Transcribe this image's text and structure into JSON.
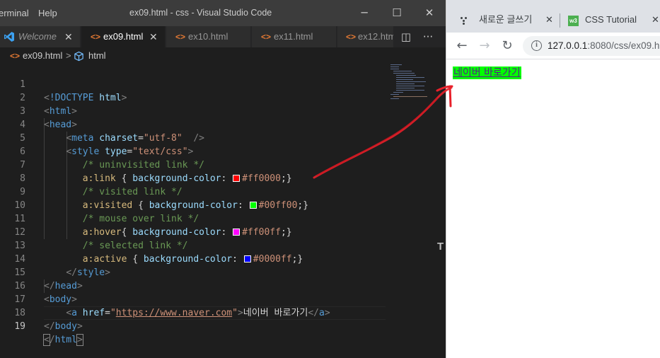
{
  "vscode": {
    "menu": [
      "erminal",
      "Help"
    ],
    "title": "ex09.html - css - Visual Studio Code",
    "window_controls": {
      "minimize": "─",
      "maximize": "☐",
      "close": "✕"
    },
    "tabs": [
      {
        "label": "Welcome",
        "icon": "vscode-logo-icon",
        "close": "✕"
      },
      {
        "label": "ex09.html",
        "icon": "html-file-icon",
        "close": "✕",
        "active": true
      },
      {
        "label": "ex10.html",
        "icon": "html-file-icon"
      },
      {
        "label": "ex11.html",
        "icon": "html-file-icon"
      },
      {
        "label": "ex12.htm",
        "icon": "html-file-icon"
      }
    ],
    "tab_icon_glyph": "<>",
    "tab_tools": {
      "split": "◫",
      "more": "···"
    },
    "breadcrumb": {
      "file": "ex09.html",
      "separator": ">",
      "symbol": "html"
    },
    "line_numbers": [
      "1",
      "2",
      "3",
      "4",
      "5",
      "6",
      "7",
      "8",
      "9",
      "10",
      "11",
      "12",
      "13",
      "14",
      "15",
      "16",
      "17",
      "18",
      "19"
    ],
    "code": {
      "doctype": "!DOCTYPE",
      "doctype_value": "html",
      "html_tag": "html",
      "head_tag": "head",
      "meta_tag": "meta",
      "charset_attr": "charset",
      "charset_value": "\"utf-8\"",
      "style_tag": "style",
      "type_attr": "type",
      "type_value": "\"text/css\"",
      "comment_unvisited": "/* uninvisited link */",
      "selector_link": "a:link",
      "comment_visited": "/* visited link */",
      "selector_visited": "a:visited",
      "comment_hover": "/* mouse over link */",
      "selector_hover": "a:hover",
      "comment_active": "/* selected link */",
      "selector_active": "a:active",
      "property": "background-color",
      "color_link": "#ff0000",
      "color_visited": "#00ff00",
      "color_hover": "#ff00ff",
      "color_active": "#0000ff",
      "body_tag": "body",
      "a_tag": "a",
      "href_attr": "href",
      "href_value": "https://www.naver.com",
      "link_text": "네이버 바로가기"
    }
  },
  "browser": {
    "tabs": [
      {
        "label": "새로운 글쓰기",
        "icon": "grid-dots-icon",
        "close": "✕"
      },
      {
        "label": "CSS Tutorial",
        "icon": "w3schools-icon",
        "close": "✕"
      }
    ],
    "w3_icon_text": "w3",
    "nav": {
      "back": "←",
      "forward": "→",
      "reload": "↻"
    },
    "info_icon": "i",
    "url_host": "127.0.0.1",
    "url_rest": ":8080/css/ex09.h",
    "page_link_text": "네이버 바로가기",
    "page_link_background": "#00ff00"
  },
  "annotation": {
    "color": "#e8202a",
    "description_icon": "red-arrow-annotation"
  }
}
